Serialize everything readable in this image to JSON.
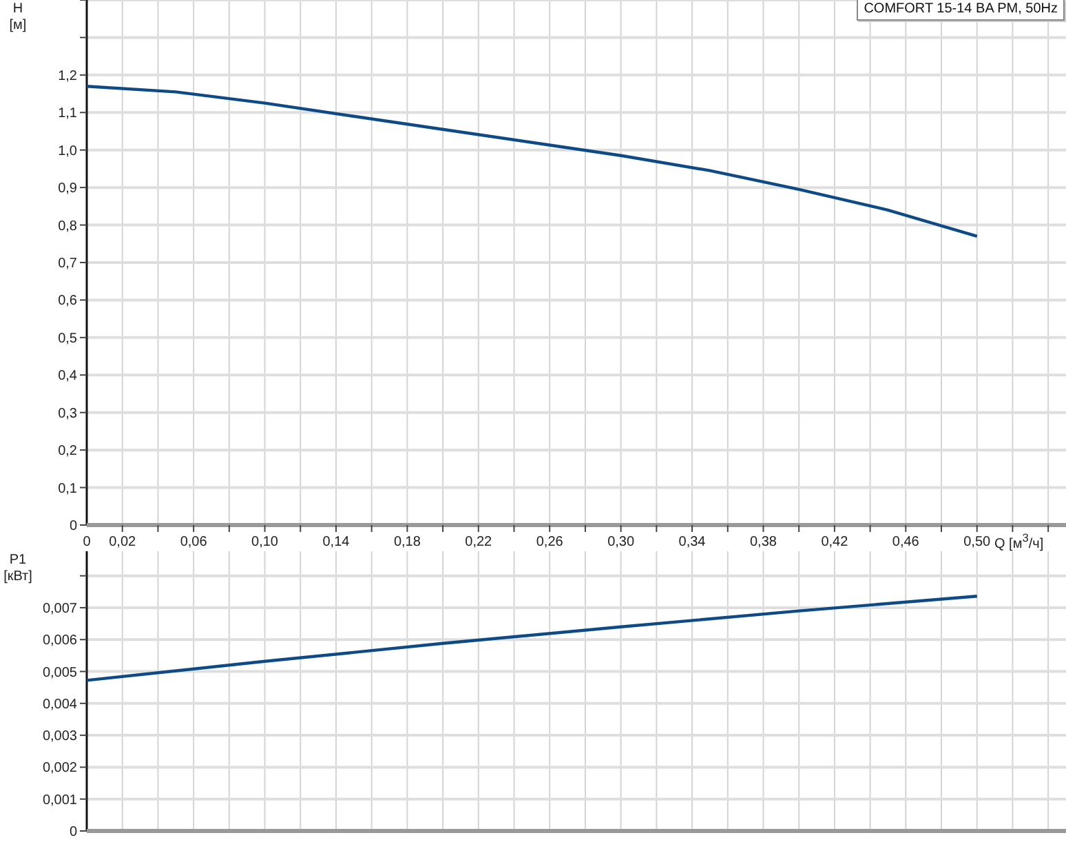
{
  "charts": [
    {
      "unit_label": "[м]",
      "chart_data": {
        "type": "line",
        "ylabel": "H",
        "xlabel": "Q [м$^{3}$/ч]",
        "x": [
          0,
          0.05,
          0.1,
          0.15,
          0.2,
          0.25,
          0.3,
          0.35,
          0.4,
          0.45,
          0.5
        ],
        "series": [
          {
            "name": "COMFORT 15-14 BA PM, 50Hz",
            "color": "#0d4a86",
            "values": [
              1.17,
              1.155,
              1.125,
              1.09,
              1.055,
              1.02,
              0.985,
              0.945,
              0.895,
              0.84,
              0.77
            ]
          }
        ],
        "xlim": [
          0,
          0.55
        ],
        "ylim": [
          0,
          1.4
        ],
        "grid": true,
        "xticks": [
          {
            "value": 0,
            "label": "0"
          },
          {
            "value": 0.02,
            "label": "0,02"
          },
          {
            "value": 0.06,
            "label": "0,06"
          },
          {
            "value": 0.1,
            "label": "0,10"
          },
          {
            "value": 0.14,
            "label": "0,14"
          },
          {
            "value": 0.18,
            "label": "0,18"
          },
          {
            "value": 0.22,
            "label": "0,22"
          },
          {
            "value": 0.26,
            "label": "0,26"
          },
          {
            "value": 0.3,
            "label": "0,30"
          },
          {
            "value": 0.34,
            "label": "0,34"
          },
          {
            "value": 0.38,
            "label": "0,38"
          },
          {
            "value": 0.42,
            "label": "0,42"
          },
          {
            "value": 0.46,
            "label": "0,46"
          },
          {
            "value": 0.5,
            "label": "0,50"
          }
        ],
        "yticks": [
          {
            "value": 0,
            "label": "0"
          },
          {
            "value": 0.1,
            "label": "0,1"
          },
          {
            "value": 0.2,
            "label": "0,2"
          },
          {
            "value": 0.3,
            "label": "0,3"
          },
          {
            "value": 0.4,
            "label": "0,4"
          },
          {
            "value": 0.5,
            "label": "0,5"
          },
          {
            "value": 0.6,
            "label": "0,6"
          },
          {
            "value": 0.7,
            "label": "0,7"
          },
          {
            "value": 0.8,
            "label": "0,8"
          },
          {
            "value": 0.9,
            "label": "0,9"
          },
          {
            "value": 1.0,
            "label": "1,0"
          },
          {
            "value": 1.1,
            "label": "1,1"
          },
          {
            "value": 1.2,
            "label": "1,2"
          }
        ]
      }
    },
    {
      "unit_label": "[кВт]",
      "chart_data": {
        "type": "line",
        "ylabel": "P1",
        "x": [
          0,
          0.1,
          0.2,
          0.3,
          0.4,
          0.5
        ],
        "series": [
          {
            "color": "#0d4a86",
            "values": [
              0.00472,
              0.00532,
              0.00588,
              0.0064,
              0.0069,
              0.00736
            ]
          }
        ],
        "xlim": [
          0,
          0.55
        ],
        "ylim": [
          0,
          0.00877
        ],
        "grid": true,
        "yticks": [
          {
            "value": 0,
            "label": "0"
          },
          {
            "value": 0.001,
            "label": "0,001"
          },
          {
            "value": 0.002,
            "label": "0,002"
          },
          {
            "value": 0.003,
            "label": "0,003"
          },
          {
            "value": 0.004,
            "label": "0,004"
          },
          {
            "value": 0.005,
            "label": "0,005"
          },
          {
            "value": 0.006,
            "label": "0,006"
          },
          {
            "value": 0.007,
            "label": "0,007"
          }
        ]
      }
    }
  ]
}
